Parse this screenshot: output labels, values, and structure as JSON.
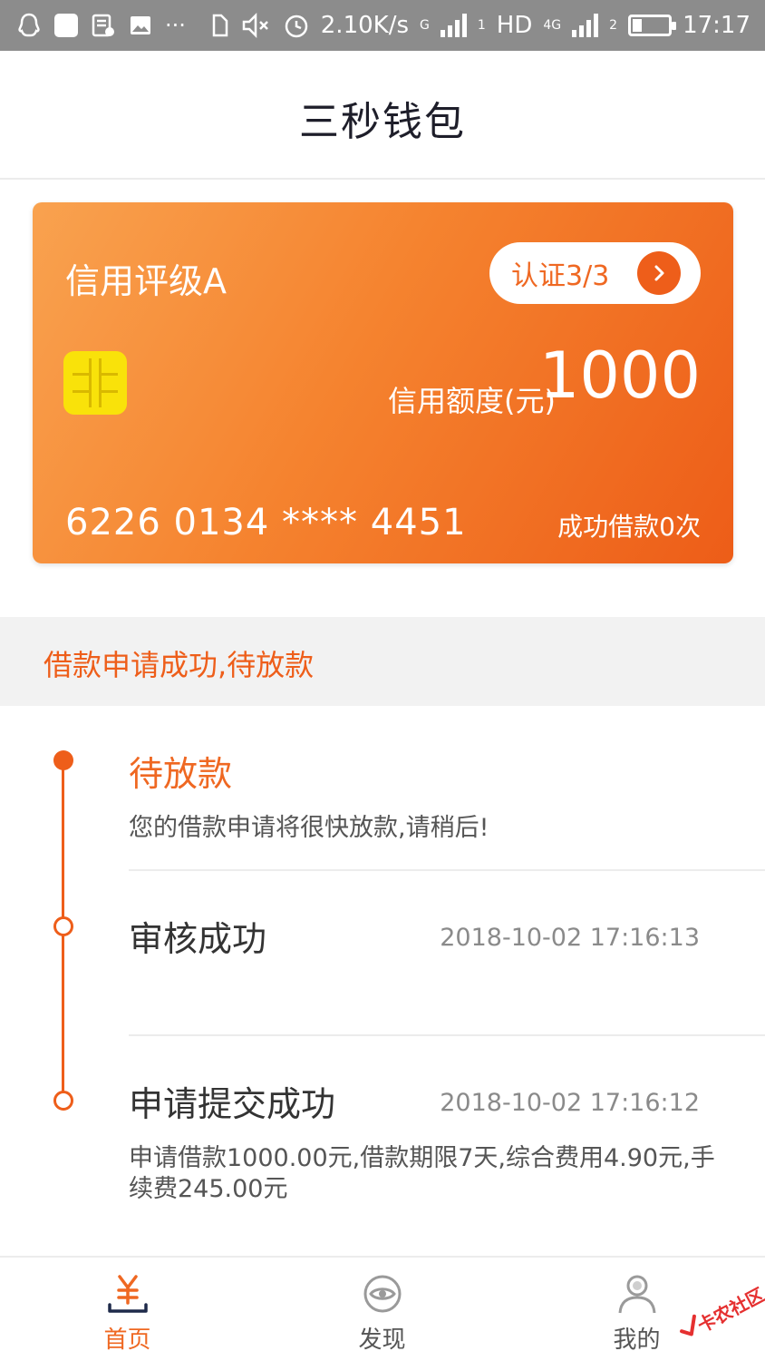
{
  "status_bar": {
    "net_speed": "2.10K/s",
    "sim1_type": "G",
    "sim1_slot": "1",
    "hd_label": "HD",
    "sim2_type": "4G",
    "sim2_slot": "2",
    "time": "17:17",
    "more": "···"
  },
  "header": {
    "title": "三秒钱包"
  },
  "card": {
    "credit_level": "信用评级A",
    "verify_button": "认证3/3",
    "limit_label": "信用额度(元)",
    "limit_value": "1000",
    "card_number": "6226 0134 **** 4451",
    "loan_count": "成功借款0次",
    "colors": {
      "start": "#f9a24f",
      "end": "#ed5d18",
      "chip": "#f9e20a"
    }
  },
  "notice": {
    "text": "借款申请成功,待放款",
    "color": "#ee5e1a"
  },
  "timeline": [
    {
      "title": "待放款",
      "time": "",
      "desc": "您的借款申请将很快放款,请稍后!",
      "active": true
    },
    {
      "title": "审核成功",
      "time": "2018-10-02 17:16:13",
      "desc": "",
      "active": false
    },
    {
      "title": "申请提交成功",
      "time": "2018-10-02 17:16:12",
      "desc": "申请借款1000.00元,借款期限7天,综合费用4.90元,手续费245.00元",
      "active": false
    }
  ],
  "bottom_nav": {
    "items": [
      {
        "label": "首页",
        "icon": "yuan-icon",
        "active": true
      },
      {
        "label": "发现",
        "icon": "eye-icon",
        "active": false
      },
      {
        "label": "我的",
        "icon": "user-icon",
        "active": false
      }
    ]
  },
  "watermark": {
    "text": "卡农社区"
  },
  "accent_color": "#ef6822"
}
